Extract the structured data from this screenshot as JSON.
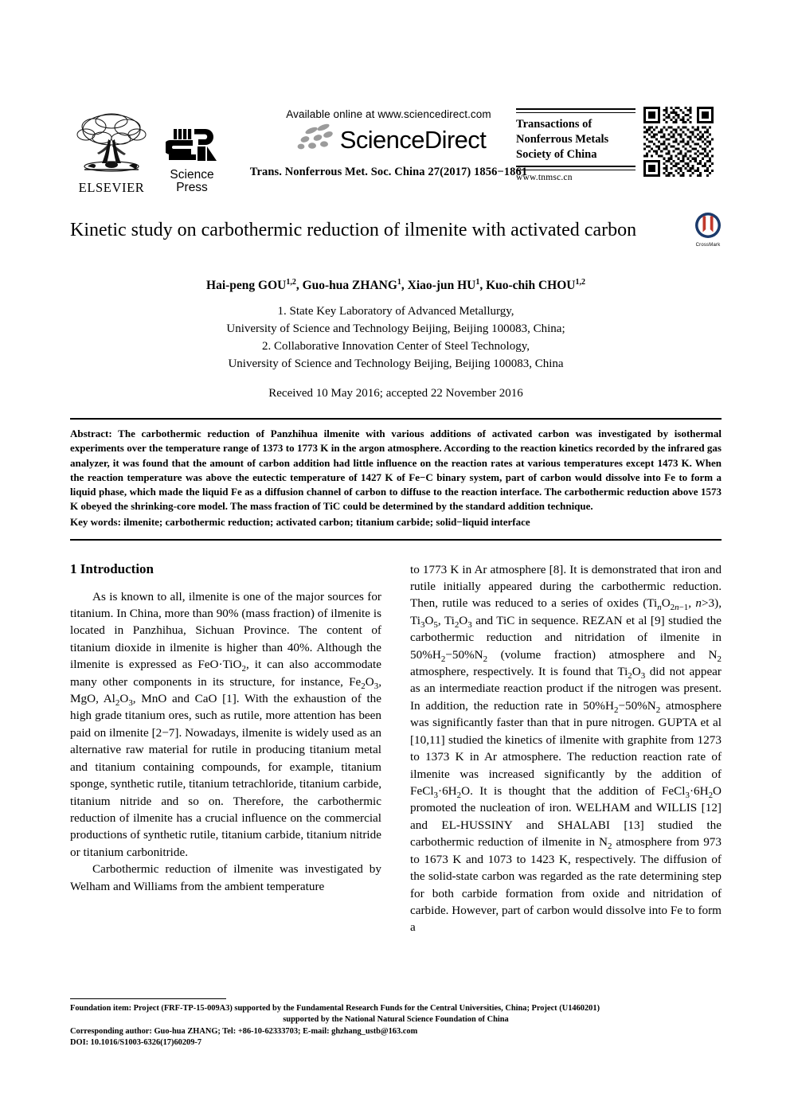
{
  "masthead": {
    "elsevier_label": "ELSEVIER",
    "science_press": {
      "line1": "Science",
      "line2": "Press"
    },
    "available_online": "Available online at www.sciencedirect.com",
    "sciencedirect_label": "ScienceDirect",
    "journal_reference": "Trans. Nonferrous Met. Soc. China 27(2017) 1856−1861",
    "journal_box": {
      "title_line1": "Transactions of",
      "title_line2": "Nonferrous Metals",
      "title_line3": "Society of China",
      "url": "www.tnmsc.cn"
    }
  },
  "article": {
    "title": "Kinetic study on carbothermic reduction of ilmenite with activated carbon",
    "crossmark_label": "CrossMark",
    "authors": "Hai-peng GOU<sup>1,2</sup>, Guo-hua ZHANG<sup>1</sup>, Xiao-jun HU<sup>1</sup>, Kuo-chih CHOU<sup>1,2</sup>",
    "affiliations": [
      "1. State Key Laboratory of Advanced Metallurgy,",
      "University of Science and Technology Beijing, Beijing 100083, China;",
      "2. Collaborative Innovation Center of Steel Technology,",
      "University of Science and Technology Beijing, Beijing 100083, China"
    ],
    "received": "Received 10 May 2016; accepted 22 November 2016"
  },
  "abstract": {
    "label": "Abstract:",
    "text": "The carbothermic reduction of Panzhihua ilmenite with various additions of activated carbon was investigated by isothermal experiments over the temperature range of 1373 to 1773 K in the argon atmosphere. According to the reaction kinetics recorded by the infrared gas analyzer, it was found that the amount of carbon addition had little influence on the reaction rates at various temperatures except 1473 K. When the reaction temperature was above the eutectic temperature of 1427 K of Fe−C binary system, part of carbon would dissolve into Fe to form a liquid phase, which made the liquid Fe as a diffusion channel of carbon to diffuse to the reaction interface. The carbothermic reduction above 1573 K obeyed the shrinking-core model. The mass fraction of TiC could be determined by the standard addition technique.",
    "keywords_label": "Key words:",
    "keywords": "ilmenite; carbothermic reduction; activated carbon; titanium carbide; solid−liquid interface"
  },
  "body": {
    "section_heading": "1 Introduction",
    "left_paragraph_1": "As is known to all, ilmenite is one of the major sources for titanium. In China, more than 90% (mass fraction) of ilmenite is located in Panzhihua, Sichuan Province. The content of titanium dioxide in ilmenite is higher than 40%. Although the ilmenite is expressed as FeO&middot;TiO<sub>2</sub>, it can also accommodate many other components in its structure, for instance, Fe<sub>2</sub>O<sub>3</sub>, MgO, Al<sub>2</sub>O<sub>3</sub>, MnO and CaO [1]. With the exhaustion of the high grade titanium ores, such as rutile, more attention has been paid on ilmenite [2−7]. Nowadays, ilmenite is widely used as an alternative raw material for rutile in producing titanium metal and titanium containing compounds, for example, titanium sponge, synthetic rutile, titanium tetrachloride, titanium carbide, titanium nitride and so on. Therefore, the carbothermic reduction of ilmenite has a crucial influence on the commercial productions of synthetic rutile, titanium carbide, titanium nitride or titanium carbonitride.",
    "left_paragraph_2": "Carbothermic reduction of ilmenite was investigated by Welham and Williams from the ambient temperature",
    "right_paragraph_1": "to 1773 K in Ar atmosphere [8]. It is demonstrated that iron and rutile initially appeared during the carbothermic reduction. Then, rutile was reduced to a series of oxides (Ti<sub><i>n</i></sub>O<sub>2<i>n</i>−1</sub>, <i>n</i>&gt;3), Ti<sub>3</sub>O<sub>5</sub>, Ti<sub>2</sub>O<sub>3</sub> and TiC in sequence. REZAN et al [9] studied the carbothermic reduction and nitridation of ilmenite in 50%H<sub>2</sub>−50%N<sub>2</sub> (volume fraction) atmosphere and N<sub>2</sub> atmosphere, respectively. It is found that Ti<sub>2</sub>O<sub>3</sub> did not appear as an intermediate reaction product if the nitrogen was present. In addition, the reduction rate in 50%H<sub>2</sub>−50%N<sub>2</sub> atmosphere was significantly faster than that in pure nitrogen. GUPTA et al [10,11] studied the kinetics of ilmenite with graphite from 1273 to 1373 K in Ar atmosphere. The reduction reaction rate of ilmenite was increased significantly by the addition of FeCl<sub>3</sub>&middot;6H<sub>2</sub>O. It is thought that the addition of FeCl<sub>3</sub>&middot;6H<sub>2</sub>O promoted the nucleation of iron. WELHAM and WILLIS [12] and EL-HUSSINY and SHALABI [13] studied the carbothermic reduction of ilmenite in N<sub>2</sub> atmosphere from 973 to 1673 K and 1073 to 1423 K, respectively. The diffusion of the solid-state carbon was regarded as the rate determining step for both carbide formation from oxide and nitridation of carbide. However, part of carbon would dissolve into Fe to form a"
  },
  "footnotes": {
    "foundation_line1": "Foundation item: Project (FRF-TP-15-009A3) supported by the Fundamental Research Funds for the Central Universities, China; Project (U1460201)",
    "foundation_line2": "supported by the National Natural Science Foundation of China",
    "corresponding": "Corresponding author: Guo-hua ZHANG; Tel: +86-10-62333703; E-mail: ghzhang_ustb@163.com",
    "doi": "DOI: 10.1016/S1003-6326(17)60209-7"
  }
}
